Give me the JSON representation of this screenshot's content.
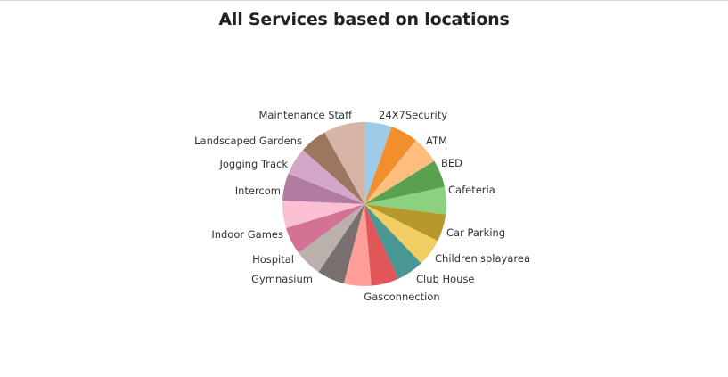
{
  "chart_data": {
    "type": "pie",
    "title": "All Services based on locations",
    "slices": [
      {
        "label": "24X7Security",
        "value": 1,
        "color": "#a0cbe8"
      },
      {
        "label": "ATM",
        "value": 1,
        "color": "#f28e2b"
      },
      {
        "label": "BED",
        "value": 1,
        "color": "#ffbe7d"
      },
      {
        "label": "Cafeteria",
        "value": 1,
        "color": "#59a14f"
      },
      {
        "label": "Cafeteria",
        "value": 1,
        "color": "#8cd17d"
      },
      {
        "label": "Car Parking",
        "value": 1,
        "color": "#b6992d"
      },
      {
        "label": "Children'splayarea",
        "value": 1,
        "color": "#f1ce63"
      },
      {
        "label": "Club House",
        "value": 1,
        "color": "#499894"
      },
      {
        "label": "Gasconnection",
        "value": 1,
        "color": "#e15759"
      },
      {
        "label": "Gasconnection",
        "value": 1,
        "color": "#ff9d9a"
      },
      {
        "label": "Gymnasium",
        "value": 1,
        "color": "#79706e"
      },
      {
        "label": "Gymnasium",
        "value": 1,
        "color": "#bab0ac"
      },
      {
        "label": "Hospital",
        "value": 1,
        "color": "#d37295"
      },
      {
        "label": "Indoor Games",
        "value": 1,
        "color": "#fabfd2"
      },
      {
        "label": "Intercom",
        "value": 1,
        "color": "#b07aa1"
      },
      {
        "label": "Jogging Track",
        "value": 1,
        "color": "#d4a6c8"
      },
      {
        "label": "Landscaped Gardens",
        "value": 1,
        "color": "#9d7660"
      },
      {
        "label": "Maintenance Staff",
        "value": 1.5,
        "color": "#d7b5a6"
      }
    ],
    "labels": [
      "24X7Security",
      "ATM",
      "BED",
      "Cafeteria",
      "Car Parking",
      "Children'splayarea",
      "Club House",
      "Gasconnection",
      "Gymnasium",
      "Hospital",
      "Indoor Games",
      "Intercom",
      "Jogging Track",
      "Landscaped Gardens",
      "Maintenance Staff"
    ]
  }
}
